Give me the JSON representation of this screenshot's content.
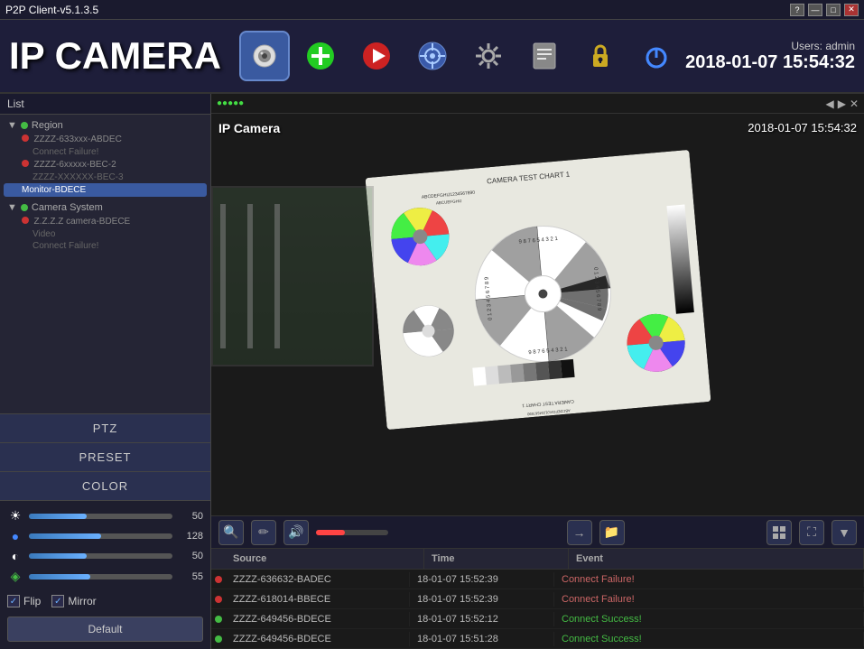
{
  "titlebar": {
    "title": "P2P Client-v5.1.3.5",
    "question": "?",
    "minimize": "—",
    "maximize": "□",
    "close": "✕"
  },
  "header": {
    "app_title": "IP CAMERA",
    "users_label": "Users: admin",
    "datetime": "2018-01-07  15:54:32",
    "toolbar_buttons": [
      {
        "id": "camera",
        "icon": "🎥",
        "active": true
      },
      {
        "id": "add",
        "icon": "➕",
        "active": false
      },
      {
        "id": "play",
        "icon": "▶",
        "active": false
      },
      {
        "id": "ptz",
        "icon": "🎯",
        "active": false
      },
      {
        "id": "settings",
        "icon": "⚙",
        "active": false
      },
      {
        "id": "files",
        "icon": "📋",
        "active": false
      },
      {
        "id": "lock",
        "icon": "🔒",
        "active": false
      },
      {
        "id": "power",
        "icon": "⏻",
        "active": false
      }
    ]
  },
  "sidebar": {
    "list_header": "List",
    "tree": [
      {
        "id": "group1",
        "label": "Region",
        "dot": "green",
        "children": [
          {
            "label": "ZZZZ-633xxx-ABDEC",
            "dot": "red",
            "selected": false
          },
          {
            "label": "Connect Failure!",
            "sub": true
          },
          {
            "label": "ZZZZ-6xxxxx-BEC-2",
            "dot": "red"
          },
          {
            "label": "ZZZZ-XXXXXX-BEC-3",
            "sub": true
          },
          {
            "label": "Monitor-BDECE",
            "selected": true
          }
        ]
      },
      {
        "id": "group2",
        "label": "Camera System",
        "dot": "green",
        "children": [
          {
            "label": "Z.Z.Z.Z camera-BDECE",
            "dot": "red"
          },
          {
            "label": "Video",
            "sub": true
          },
          {
            "label": "Connect Failure!",
            "sub": true
          }
        ]
      }
    ],
    "controls": {
      "ptz_label": "PTZ",
      "preset_label": "PRESET",
      "color_label": "COLOR"
    },
    "color_sliders": [
      {
        "icon": "☀",
        "value": 50,
        "percent": 40
      },
      {
        "icon": "🔵",
        "value": 128,
        "percent": 50
      },
      {
        "icon": "◐",
        "value": 50,
        "percent": 40
      },
      {
        "icon": "🎨",
        "value": 55,
        "percent": 43
      }
    ],
    "checkboxes": {
      "flip_label": "Flip",
      "flip_checked": true,
      "mirror_label": "Mirror",
      "mirror_checked": true
    },
    "default_btn": "Default"
  },
  "video": {
    "camera_label": "IP Camera",
    "datetime_overlay": "2018-01-07  15:54:32",
    "status_indicator": "●●●●●",
    "top_icons": [
      "◀",
      "▶",
      "✕"
    ]
  },
  "video_controls": {
    "zoom_icon": "🔍",
    "pencil_icon": "✏",
    "volume_icon": "🔊",
    "arrow_icon": "→",
    "folder_icon": "📁",
    "grid_icon": "⊞",
    "expand_icon": "⛶",
    "down_icon": "▼"
  },
  "event_log": {
    "columns": [
      "Source",
      "Time",
      "Event"
    ],
    "rows": [
      {
        "dot": "red",
        "source": "ZZZZ-636632-BADEC",
        "time": "18-01-07 15:52:39",
        "event": "Connect Failure!",
        "status": "failure"
      },
      {
        "dot": "red",
        "source": "ZZZZ-618014-BBECE",
        "time": "18-01-07 15:52:39",
        "event": "Connect Failure!",
        "status": "failure"
      },
      {
        "dot": "green",
        "source": "ZZZZ-649456-BDECE",
        "time": "18-01-07 15:52:12",
        "event": "Connect Success!",
        "status": "success"
      },
      {
        "dot": "green",
        "source": "ZZZZ-649456-BDECE",
        "time": "18-01-07 15:51:28",
        "event": "Connect Success!",
        "status": "success"
      }
    ]
  }
}
